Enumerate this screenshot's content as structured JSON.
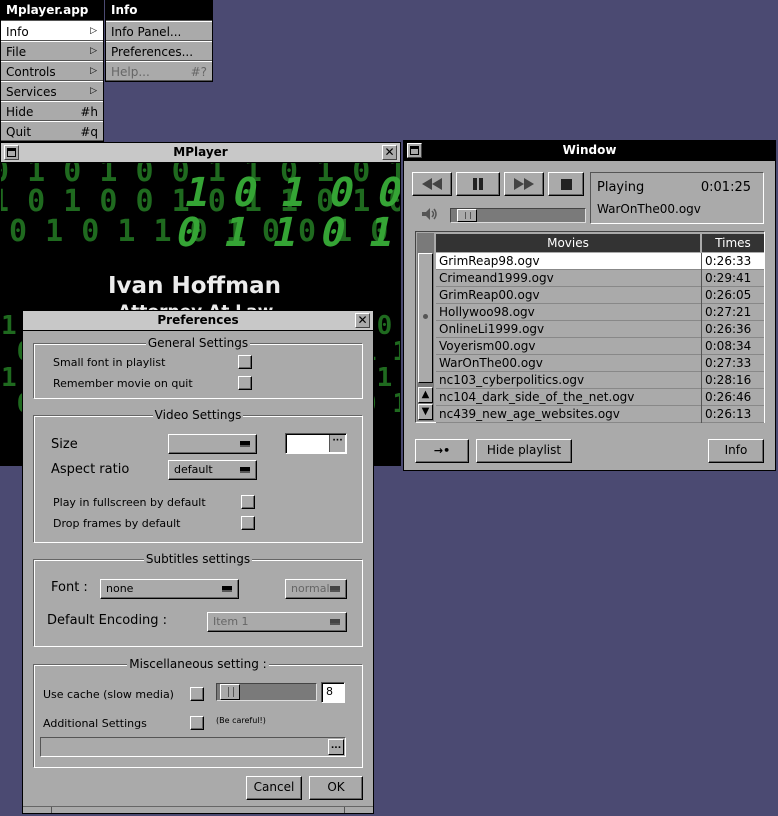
{
  "app_menu": {
    "title": "Mplayer.app",
    "items": [
      {
        "label": "Info",
        "submenu": true
      },
      {
        "label": "File",
        "submenu": true
      },
      {
        "label": "Controls",
        "submenu": true
      },
      {
        "label": "Services",
        "submenu": true
      },
      {
        "label": "Hide",
        "shortcut": "#h"
      },
      {
        "label": "Quit",
        "shortcut": "#q"
      }
    ]
  },
  "info_menu": {
    "title": "Info",
    "items": [
      {
        "label": "Info Panel..."
      },
      {
        "label": "Preferences..."
      },
      {
        "label": "Help...",
        "shortcut": "#?"
      }
    ]
  },
  "player_window": {
    "title": "MPlayer",
    "overlay_name": "Ivan Hoffman",
    "overlay_subtitle": "Attorney At Law"
  },
  "playlist_window": {
    "title": "Window",
    "status": "Playing",
    "time": "0:01:25",
    "current_file": "WarOnThe00.ogv",
    "volume_fraction": 0.05,
    "col_movies": "Movies",
    "col_times": "Times",
    "rows": [
      {
        "name": "GrimReap98.ogv",
        "time": "0:26:33"
      },
      {
        "name": "Crimeand1999.ogv",
        "time": "0:29:41"
      },
      {
        "name": "GrimReap00.ogv",
        "time": "0:26:05"
      },
      {
        "name": "Hollywoo98.ogv",
        "time": "0:27:21"
      },
      {
        "name": "OnlineLi1999.ogv",
        "time": "0:26:36"
      },
      {
        "name": "Voyerism00.ogv",
        "time": "0:08:34"
      },
      {
        "name": "WarOnThe00.ogv",
        "time": "0:27:33"
      },
      {
        "name": "nc103_cyberpolitics.ogv",
        "time": "0:28:16"
      },
      {
        "name": "nc104_dark_side_of_the_net.ogv",
        "time": "0:26:46"
      },
      {
        "name": "nc439_new_age_websites.ogv",
        "time": "0:26:13"
      }
    ],
    "hide_playlist_label": "Hide playlist",
    "info_label": "Info",
    "repeat_glyph": "→•"
  },
  "preferences": {
    "title": "Preferences",
    "general": {
      "title": "General Settings",
      "small_font": "Small font in playlist",
      "remember": "Remember movie on quit"
    },
    "video": {
      "title": "Video Settings",
      "size_label": "Size",
      "size_value": "",
      "aspect_label": "Aspect ratio",
      "aspect_value": "default",
      "fullscreen": "Play in fullscreen by default",
      "drop_frames": "Drop frames by default"
    },
    "subtitles": {
      "title": "Subtitles settings",
      "font_label": "Font :",
      "font_value": "none",
      "style_value": "normal",
      "encoding_label": "Default Encoding :",
      "encoding_value": "Item 1"
    },
    "misc": {
      "title": "Miscellaneous setting :",
      "cache_label": "Use cache (slow media)",
      "cache_value": "8",
      "cache_fraction": 0.04,
      "additional_label": "Additional Settings",
      "careful": "(Be careful!)",
      "ellipsis": "..."
    },
    "cancel": "Cancel",
    "ok": "OK"
  },
  "colors": {
    "desktop": "#4b4a72",
    "window_bg": "#aaaaaa",
    "titlebar_active": "#000000",
    "matrix_green": "#35a435"
  },
  "icons": {
    "rewind": "rewind-icon",
    "pause": "pause-icon",
    "forward": "fast-forward-icon",
    "stop": "stop-icon",
    "volume": "speaker-icon",
    "close": "close-icon",
    "miniaturize": "miniaturize-icon"
  }
}
